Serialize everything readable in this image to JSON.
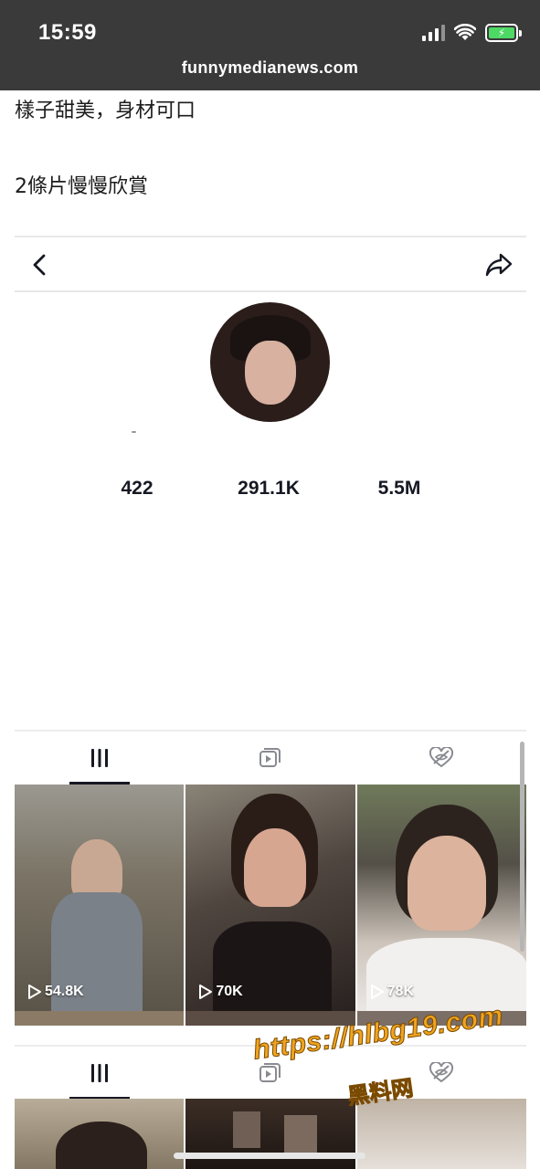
{
  "status_bar": {
    "time": "15:59",
    "battery_color": "#4cd964"
  },
  "browser": {
    "url": "funnymedianews.com"
  },
  "article": {
    "line1": "樣子甜美，身材可口",
    "line2": "2條片慢慢欣賞"
  },
  "profile": {
    "icons": {
      "back": "chevron-left-icon",
      "share": "share-arrow-icon"
    },
    "stats": {
      "following": "422",
      "followers": "291.1K",
      "likes": "5.5M"
    },
    "tabs": [
      "videos-grid-icon",
      "reposts-icon",
      "liked-private-icon"
    ]
  },
  "videos": [
    {
      "views": "54.8K"
    },
    {
      "views": "70K"
    },
    {
      "views": "78K"
    }
  ],
  "watermark": {
    "url": "https://hlbg19.com",
    "name": "黑料网"
  }
}
